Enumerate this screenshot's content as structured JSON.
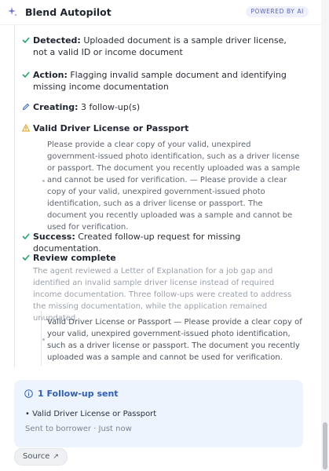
{
  "header": {
    "title": "Blend Autopilot",
    "badge": "POWERED BY AI"
  },
  "steps": {
    "detected": {
      "label": "Detected:",
      "text": "Uploaded document is a sample driver license, not a valid ID or income document"
    },
    "action": {
      "label": "Action:",
      "text": "Flagging invalid sample document and identifying missing income documentation"
    },
    "creating": {
      "label": "Creating:",
      "text": "3 follow-up(s)"
    },
    "warning": {
      "label": "Valid Driver License or Passport",
      "detail": "Please provide a clear copy of your valid, unexpired government-issued photo identification, such as a driver license or passport. The document you recently uploaded was a sample and cannot be used for verification. — Please provide a clear copy of your valid, unexpired government-issued photo identification, such as a driver license or passport. The document you recently uploaded was a sample and cannot be used for verification."
    },
    "success": {
      "label": "Success:",
      "text": "Created follow-up request for missing documentation."
    },
    "review": {
      "label": "Review complete",
      "summary": "The agent reviewed a Letter of Explanation for a job gap and identified an invalid sample driver license instead of required income documentation. Three follow-ups were created to address the missing documentation, while the application remained unupdated.",
      "item": "Valid Driver License or Passport — Please provide a clear copy of your valid, unexpired government-issued photo identification, such as a driver license or passport. The document you recently uploaded was a sample and cannot be used for verification."
    }
  },
  "card": {
    "title": "1 Follow-up sent",
    "item": "• Valid Driver License or Passport",
    "meta": "Sent to borrower · Just now"
  },
  "source": {
    "label": "Source",
    "arrow": "↗"
  },
  "colors": {
    "success": "#24a36b",
    "warning": "#e0a21a",
    "accent": "#2f5fb5",
    "badge_bg": "#eef0fb"
  },
  "icons": [
    "sparkle-icon",
    "check-icon",
    "pencil-icon",
    "warning-icon",
    "info-icon",
    "external-link-icon"
  ]
}
